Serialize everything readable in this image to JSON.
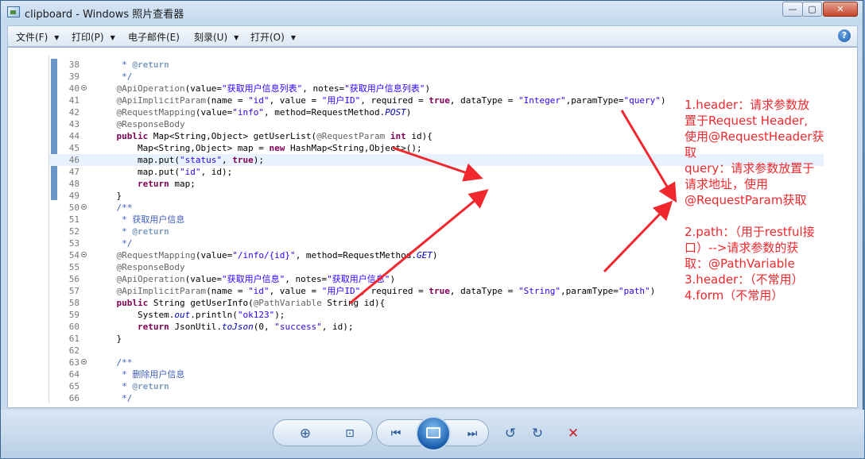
{
  "window": {
    "title": "clipboard - Windows 照片查看器",
    "minimize_glyph": "—",
    "maximize_glyph": "▢",
    "close_glyph": "✕"
  },
  "menu": {
    "file": "文件(F)",
    "print": "打印(P)",
    "email": "电子邮件(E)",
    "burn": "刻录(U)",
    "open": "打开(O)",
    "help_glyph": "?"
  },
  "code_lines": [
    {
      "n": "38",
      "fold": false,
      "hl": false,
      "parts": [
        [
          "cm",
          "     * "
        ],
        [
          "cmk",
          "@return"
        ]
      ]
    },
    {
      "n": "39",
      "fold": false,
      "hl": false,
      "parts": [
        [
          "cm",
          "     */"
        ]
      ]
    },
    {
      "n": "40",
      "fold": true,
      "hl": false,
      "parts": [
        [
          "ann",
          "    @ApiOperation"
        ],
        [
          "",
          "(value="
        ],
        [
          "str",
          "\"获取用户信息列表\""
        ],
        [
          "",
          ", notes="
        ],
        [
          "str",
          "\"获取用户信息列表\""
        ],
        [
          "",
          ")"
        ]
      ]
    },
    {
      "n": "41",
      "fold": false,
      "hl": false,
      "parts": [
        [
          "ann",
          "    @ApiImplicitParam"
        ],
        [
          "",
          "(name = "
        ],
        [
          "str",
          "\"id\""
        ],
        [
          "",
          ", value = "
        ],
        [
          "str",
          "\"用户ID\""
        ],
        [
          "",
          ", required = "
        ],
        [
          "kw",
          "true"
        ],
        [
          "",
          ", dataType = "
        ],
        [
          "str",
          "\"Integer\""
        ],
        [
          "",
          ",paramType="
        ],
        [
          "str",
          "\"query\""
        ],
        [
          "",
          ")"
        ]
      ]
    },
    {
      "n": "42",
      "fold": false,
      "hl": false,
      "parts": [
        [
          "ann",
          "    @RequestMapping"
        ],
        [
          "",
          "(value="
        ],
        [
          "str",
          "\"info\""
        ],
        [
          "",
          ", method=RequestMethod."
        ],
        [
          "ital",
          "POST"
        ],
        [
          "",
          ")"
        ]
      ]
    },
    {
      "n": "43",
      "fold": false,
      "hl": false,
      "parts": [
        [
          "ann",
          "    @ResponseBody"
        ]
      ]
    },
    {
      "n": "44",
      "fold": false,
      "hl": false,
      "parts": [
        [
          "kw",
          "    public"
        ],
        [
          "",
          " Map<String,Object> getUserList("
        ],
        [
          "ann",
          "@RequestParam"
        ],
        [
          "",
          ""
        ],
        [
          "kw",
          " int"
        ],
        [
          "",
          " id){"
        ]
      ]
    },
    {
      "n": "45",
      "fold": false,
      "hl": false,
      "parts": [
        [
          "",
          "        Map<String,Object> map = "
        ],
        [
          "kw",
          "new"
        ],
        [
          "",
          " HashMap<String,Object>();"
        ]
      ]
    },
    {
      "n": "46",
      "fold": false,
      "hl": true,
      "parts": [
        [
          "",
          "        map.put("
        ],
        [
          "str",
          "\"status\""
        ],
        [
          "",
          ", "
        ],
        [
          "kw",
          "true"
        ],
        [
          "",
          ");"
        ]
      ]
    },
    {
      "n": "47",
      "fold": false,
      "hl": false,
      "parts": [
        [
          "",
          "        map.put("
        ],
        [
          "str",
          "\"id\""
        ],
        [
          "",
          ", id);"
        ]
      ]
    },
    {
      "n": "48",
      "fold": false,
      "hl": false,
      "parts": [
        [
          "kw",
          "        return"
        ],
        [
          "",
          " map;"
        ]
      ]
    },
    {
      "n": "49",
      "fold": false,
      "hl": false,
      "parts": [
        [
          "",
          "    }"
        ]
      ]
    },
    {
      "n": "50",
      "fold": true,
      "hl": false,
      "parts": [
        [
          "cm",
          "    /**"
        ]
      ]
    },
    {
      "n": "51",
      "fold": false,
      "hl": false,
      "parts": [
        [
          "cm",
          "     * 获取用户信息"
        ]
      ]
    },
    {
      "n": "52",
      "fold": false,
      "hl": false,
      "parts": [
        [
          "cm",
          "     * "
        ],
        [
          "cmk",
          "@return"
        ]
      ]
    },
    {
      "n": "53",
      "fold": false,
      "hl": false,
      "parts": [
        [
          "cm",
          "     */"
        ]
      ]
    },
    {
      "n": "54",
      "fold": true,
      "hl": false,
      "parts": [
        [
          "ann",
          "    @RequestMapping"
        ],
        [
          "",
          "(value="
        ],
        [
          "str",
          "\"/info/{id}\""
        ],
        [
          "",
          ", method=RequestMethod."
        ],
        [
          "ital",
          "GET"
        ],
        [
          "",
          ")"
        ]
      ]
    },
    {
      "n": "55",
      "fold": false,
      "hl": false,
      "parts": [
        [
          "ann",
          "    @ResponseBody"
        ]
      ]
    },
    {
      "n": "56",
      "fold": false,
      "hl": false,
      "parts": [
        [
          "ann",
          "    @ApiOperation"
        ],
        [
          "",
          "(value="
        ],
        [
          "str",
          "\"获取用户信息\""
        ],
        [
          "",
          ", notes="
        ],
        [
          "str",
          "\"获取用户信息\""
        ],
        [
          "",
          ")"
        ]
      ]
    },
    {
      "n": "57",
      "fold": false,
      "hl": false,
      "parts": [
        [
          "ann",
          "    @ApiImplicitParam"
        ],
        [
          "",
          "(name = "
        ],
        [
          "str",
          "\"id\""
        ],
        [
          "",
          ", value = "
        ],
        [
          "str",
          "\"用户ID\""
        ],
        [
          "",
          ", required = "
        ],
        [
          "kw",
          "true"
        ],
        [
          "",
          ", dataType = "
        ],
        [
          "str",
          "\"String\""
        ],
        [
          "",
          ",paramType="
        ],
        [
          "str",
          "\"path\""
        ],
        [
          "",
          ")"
        ]
      ]
    },
    {
      "n": "58",
      "fold": false,
      "hl": false,
      "parts": [
        [
          "kw",
          "    public"
        ],
        [
          "",
          " String getUserInfo("
        ],
        [
          "ann",
          "@PathVariable"
        ],
        [
          "",
          " String id){"
        ]
      ]
    },
    {
      "n": "59",
      "fold": false,
      "hl": false,
      "parts": [
        [
          "",
          "        System."
        ],
        [
          "ital",
          "out"
        ],
        [
          "",
          ".println("
        ],
        [
          "str",
          "\"ok123\""
        ],
        [
          "",
          ");"
        ]
      ]
    },
    {
      "n": "60",
      "fold": false,
      "hl": false,
      "parts": [
        [
          "kw",
          "        return"
        ],
        [
          "",
          " JsonUtil."
        ],
        [
          "ital",
          "toJson"
        ],
        [
          "",
          "(0, "
        ],
        [
          "str",
          "\"success\""
        ],
        [
          "",
          ", id);"
        ]
      ]
    },
    {
      "n": "61",
      "fold": false,
      "hl": false,
      "parts": [
        [
          "",
          "    }"
        ]
      ]
    },
    {
      "n": "62",
      "fold": false,
      "hl": false,
      "parts": [
        [
          "",
          ""
        ]
      ]
    },
    {
      "n": "63",
      "fold": true,
      "hl": false,
      "parts": [
        [
          "cm",
          "    /**"
        ]
      ]
    },
    {
      "n": "64",
      "fold": false,
      "hl": false,
      "parts": [
        [
          "cm",
          "     * 删除用户信息"
        ]
      ]
    },
    {
      "n": "65",
      "fold": false,
      "hl": false,
      "parts": [
        [
          "cm",
          "     * "
        ],
        [
          "cmk",
          "@return"
        ]
      ]
    },
    {
      "n": "66",
      "fold": false,
      "hl": false,
      "parts": [
        [
          "cm",
          "     */"
        ]
      ]
    }
  ],
  "notes": [
    "1.header：请求参数放",
    "置于Request Header,",
    "使用@RequestHeader获",
    "取",
    "query：请求参数放置于",
    "请求地址，使用",
    "@RequestParam获取",
    "",
    "2.path：（用于restful接",
    "口）-->请求参数的获",
    "取：@PathVariable",
    "3.header：（不常用）",
    "4.form（不常用）"
  ],
  "toolbar": {
    "zoom_glyph": "⊕",
    "actual_size_glyph": "⊡",
    "prev_glyph": "⏮",
    "next_glyph": "⏭",
    "rotate_left_glyph": "↺",
    "rotate_right_glyph": "↻",
    "delete_glyph": "✕"
  },
  "colors": {
    "annotation_red": "#f0282d",
    "keyword": "#7f0055",
    "string": "#2a00ff",
    "comment": "#3f5fbf"
  }
}
